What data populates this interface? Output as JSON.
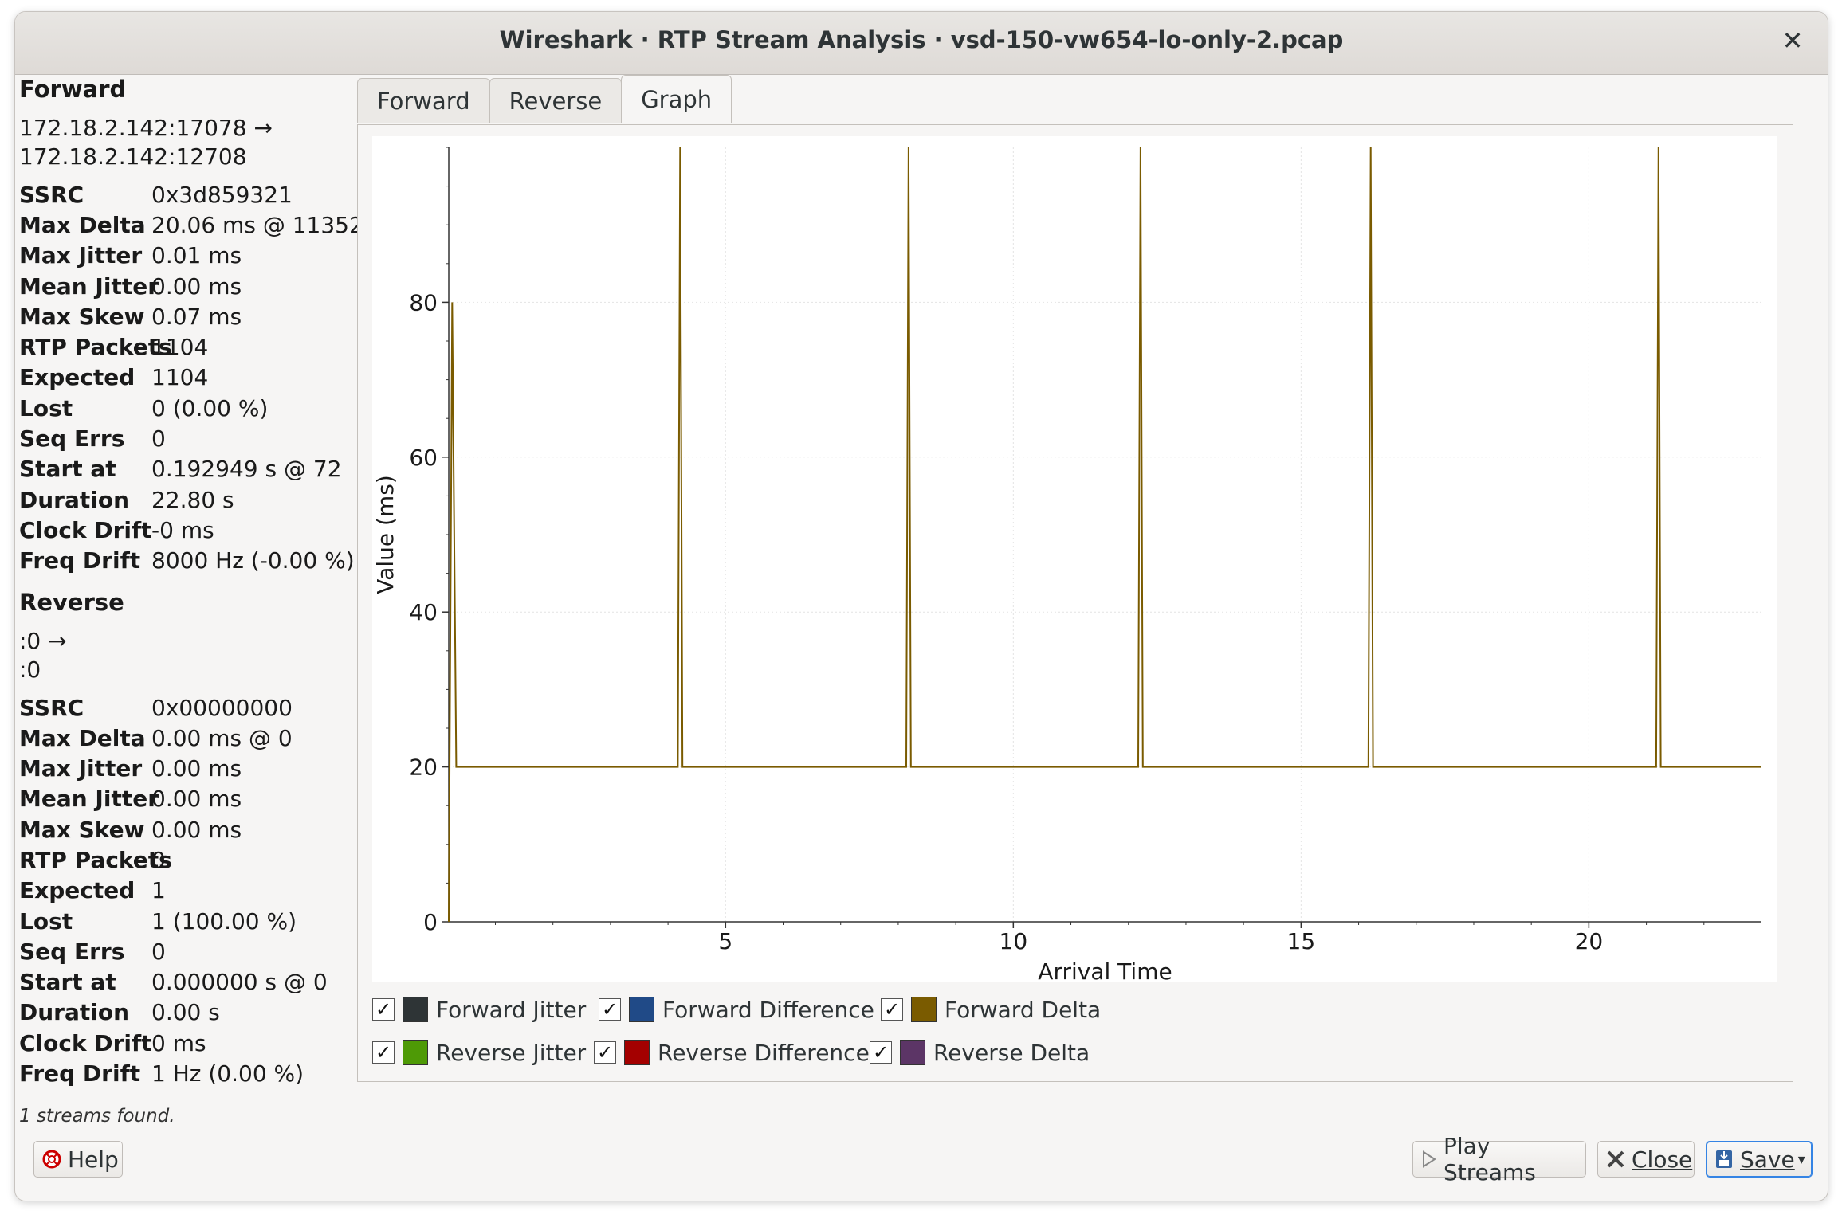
{
  "window": {
    "title": "Wireshark · RTP Stream Analysis · vsd-150-vw654-lo-only-2.pcap"
  },
  "forward": {
    "title": "Forward",
    "addr_line1": "172.18.2.142:17078 →",
    "addr_line2": "172.18.2.142:12708",
    "stats": [
      {
        "k": "SSRC",
        "v": "0x3d859321"
      },
      {
        "k": "Max Delta",
        "v": "20.06 ms @ 11352"
      },
      {
        "k": "Max Jitter",
        "v": "0.01 ms"
      },
      {
        "k": "Mean Jitter",
        "v": "0.00 ms"
      },
      {
        "k": "Max Skew",
        "v": "0.07 ms"
      },
      {
        "k": "RTP Packets",
        "v": "1104"
      },
      {
        "k": "Expected",
        "v": "1104"
      },
      {
        "k": "Lost",
        "v": "0 (0.00 %)"
      },
      {
        "k": "Seq Errs",
        "v": "0"
      },
      {
        "k": "Start at",
        "v": "0.192949 s @ 72"
      },
      {
        "k": "Duration",
        "v": "22.80 s"
      },
      {
        "k": "Clock Drift",
        "v": "-0 ms"
      },
      {
        "k": "Freq Drift",
        "v": "8000 Hz (-0.00 %)"
      }
    ]
  },
  "reverse": {
    "title": "Reverse",
    "addr_line1": ":0 →",
    "addr_line2": ":0",
    "stats": [
      {
        "k": "SSRC",
        "v": "0x00000000"
      },
      {
        "k": "Max Delta",
        "v": "0.00 ms @ 0"
      },
      {
        "k": "Max Jitter",
        "v": "0.00 ms"
      },
      {
        "k": "Mean Jitter",
        "v": "0.00 ms"
      },
      {
        "k": "Max Skew",
        "v": "0.00 ms"
      },
      {
        "k": "RTP Packets",
        "v": "0"
      },
      {
        "k": "Expected",
        "v": "1"
      },
      {
        "k": "Lost",
        "v": "1 (100.00 %)"
      },
      {
        "k": "Seq Errs",
        "v": "0"
      },
      {
        "k": "Start at",
        "v": "0.000000 s @ 0"
      },
      {
        "k": "Duration",
        "v": "0.00 s"
      },
      {
        "k": "Clock Drift",
        "v": "0 ms"
      },
      {
        "k": "Freq Drift",
        "v": "1 Hz (0.00 %)"
      }
    ]
  },
  "status": "1 streams found.",
  "tabs": [
    {
      "label": "Forward",
      "active": false
    },
    {
      "label": "Reverse",
      "active": false
    },
    {
      "label": "Graph",
      "active": true
    }
  ],
  "legend": [
    {
      "label": "Forward Jitter",
      "color": "#2e3436",
      "checked": "✓"
    },
    {
      "label": "Forward Difference",
      "color": "#204a87",
      "checked": "✓"
    },
    {
      "label": "Forward Delta",
      "color": "#7a5b00",
      "checked": "✓"
    },
    {
      "label": "Reverse Jitter",
      "color": "#4e9a06",
      "checked": "✓"
    },
    {
      "label": "Reverse Difference",
      "color": "#a40000",
      "checked": "✓"
    },
    {
      "label": "Reverse Delta",
      "color": "#5c3566",
      "checked": "✓"
    }
  ],
  "buttons": {
    "help": "Help",
    "play": "Play Streams",
    "close": "Close",
    "save": "Save"
  },
  "chart_data": {
    "type": "line",
    "title": "",
    "xlabel": "Arrival Time",
    "ylabel": "Value (ms)",
    "xlim": [
      0.19,
      23.0
    ],
    "ylim": [
      0,
      100
    ],
    "x_ticks": [
      5,
      10,
      15,
      20
    ],
    "y_ticks": [
      0,
      20,
      40,
      60,
      80
    ],
    "grid": true,
    "series": [
      {
        "name": "Forward Delta",
        "color": "#7a5b00",
        "x": [
          0.19,
          0.25,
          0.32,
          0.36,
          4.17,
          4.21,
          4.25,
          8.14,
          8.18,
          8.22,
          12.17,
          12.21,
          12.25,
          16.17,
          16.21,
          16.25,
          21.17,
          21.21,
          21.25,
          23.0
        ],
        "y": [
          0,
          80,
          20,
          20,
          20,
          100,
          20,
          20,
          100,
          20,
          20,
          100,
          20,
          20,
          100,
          20,
          20,
          100,
          20,
          20
        ]
      }
    ]
  }
}
